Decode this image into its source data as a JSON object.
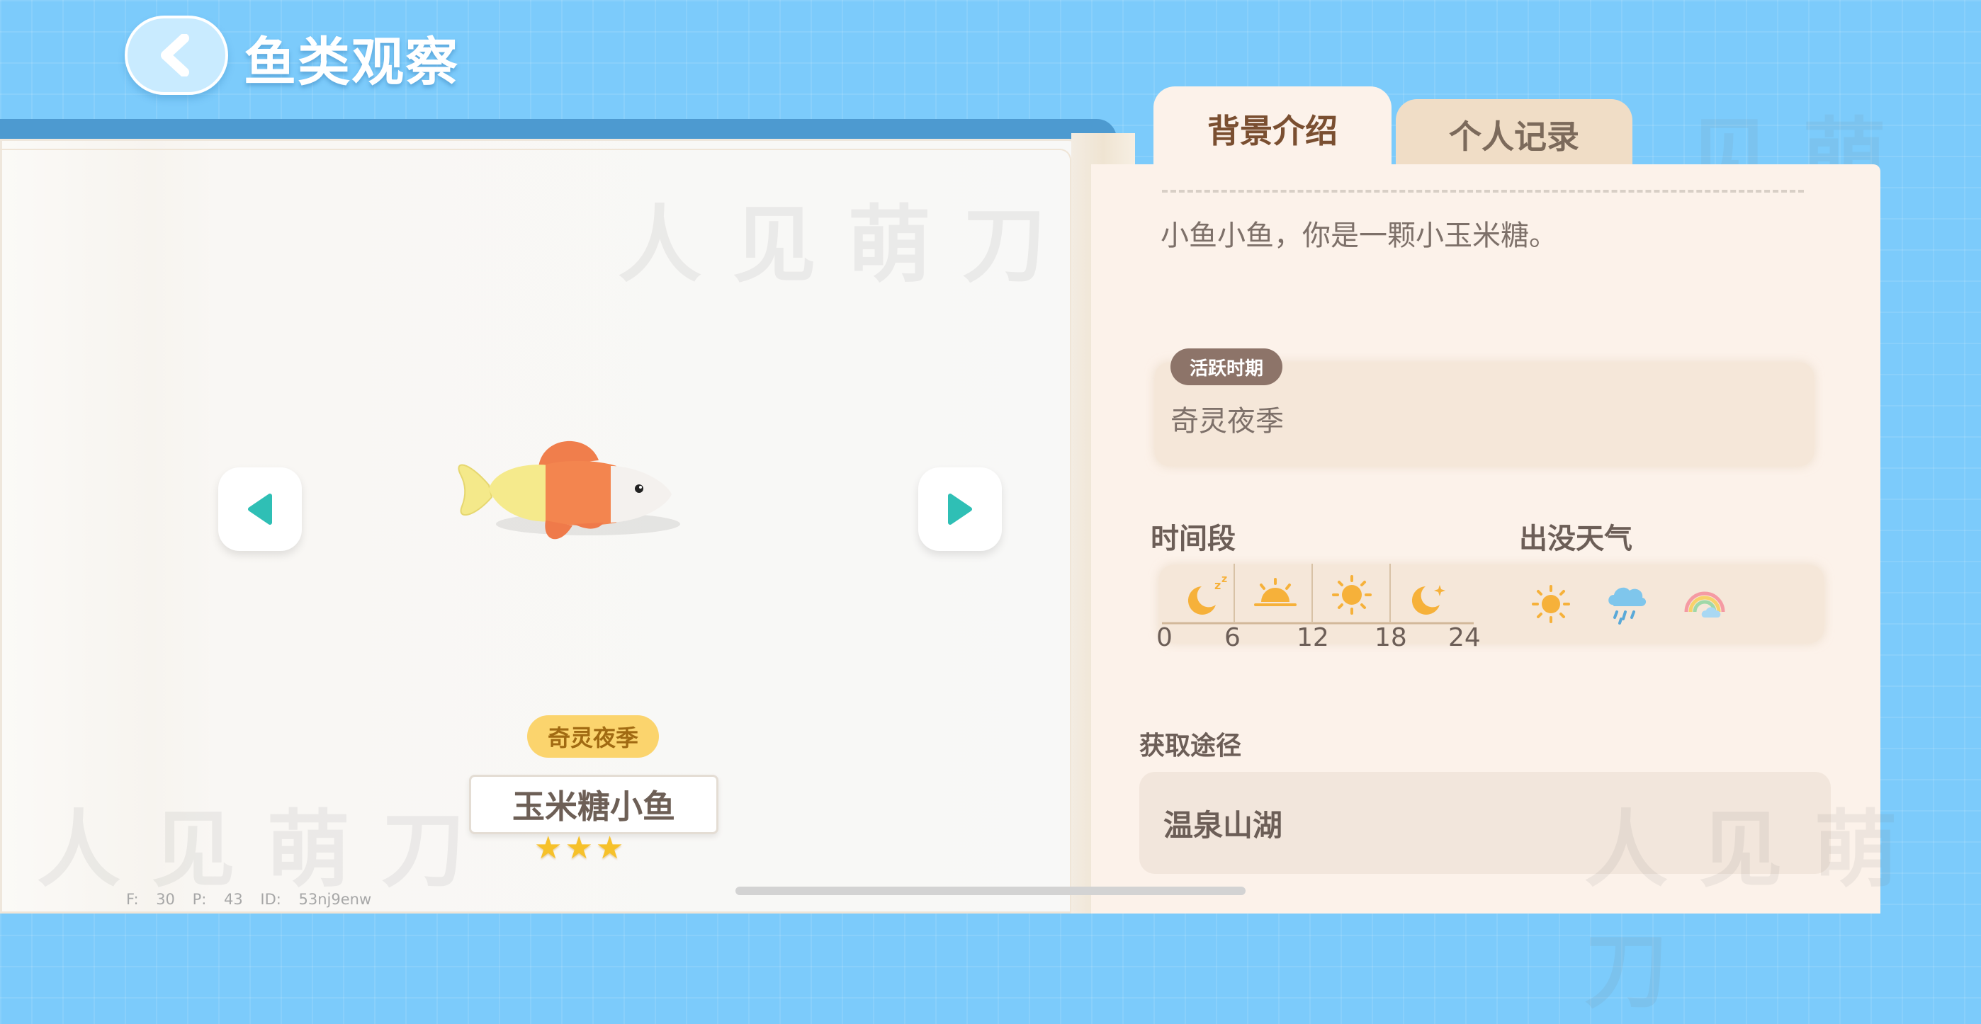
{
  "header": {
    "title": "鱼类观察"
  },
  "tabs": [
    {
      "label": "背景介绍",
      "active": true
    },
    {
      "label": "个人记录",
      "active": false
    }
  ],
  "fish": {
    "name": "玉米糖小鱼",
    "season_badge": "奇灵夜季",
    "stars": "★★★",
    "rarity": 3,
    "description": "小鱼小鱼，你是一颗小玉米糖。"
  },
  "active_period": {
    "label": "活跃时期",
    "value": "奇灵夜季"
  },
  "time_section": {
    "title": "时间段",
    "ticks": [
      "0",
      "6",
      "12",
      "18",
      "24"
    ],
    "icons": [
      "moon-sleep-icon",
      "sunrise-icon",
      "sun-icon",
      "moon-star-icon"
    ]
  },
  "weather_section": {
    "title": "出没天气",
    "icons": [
      "sunny-icon",
      "rain-cloud-icon",
      "rainbow-icon"
    ]
  },
  "obtain": {
    "title": "获取途径",
    "location": "温泉山湖"
  },
  "debug": {
    "text": "F: 30   P: 43   ID: 53nj9enw"
  },
  "watermark": "人见萌刀",
  "colors": {
    "sky_blue": "#7ccbfb",
    "badge_yellow": "#fbd46d",
    "arrow_teal": "#2fbfb5",
    "icon_orange": "#f6b13a",
    "label_brown": "#8d7469"
  }
}
